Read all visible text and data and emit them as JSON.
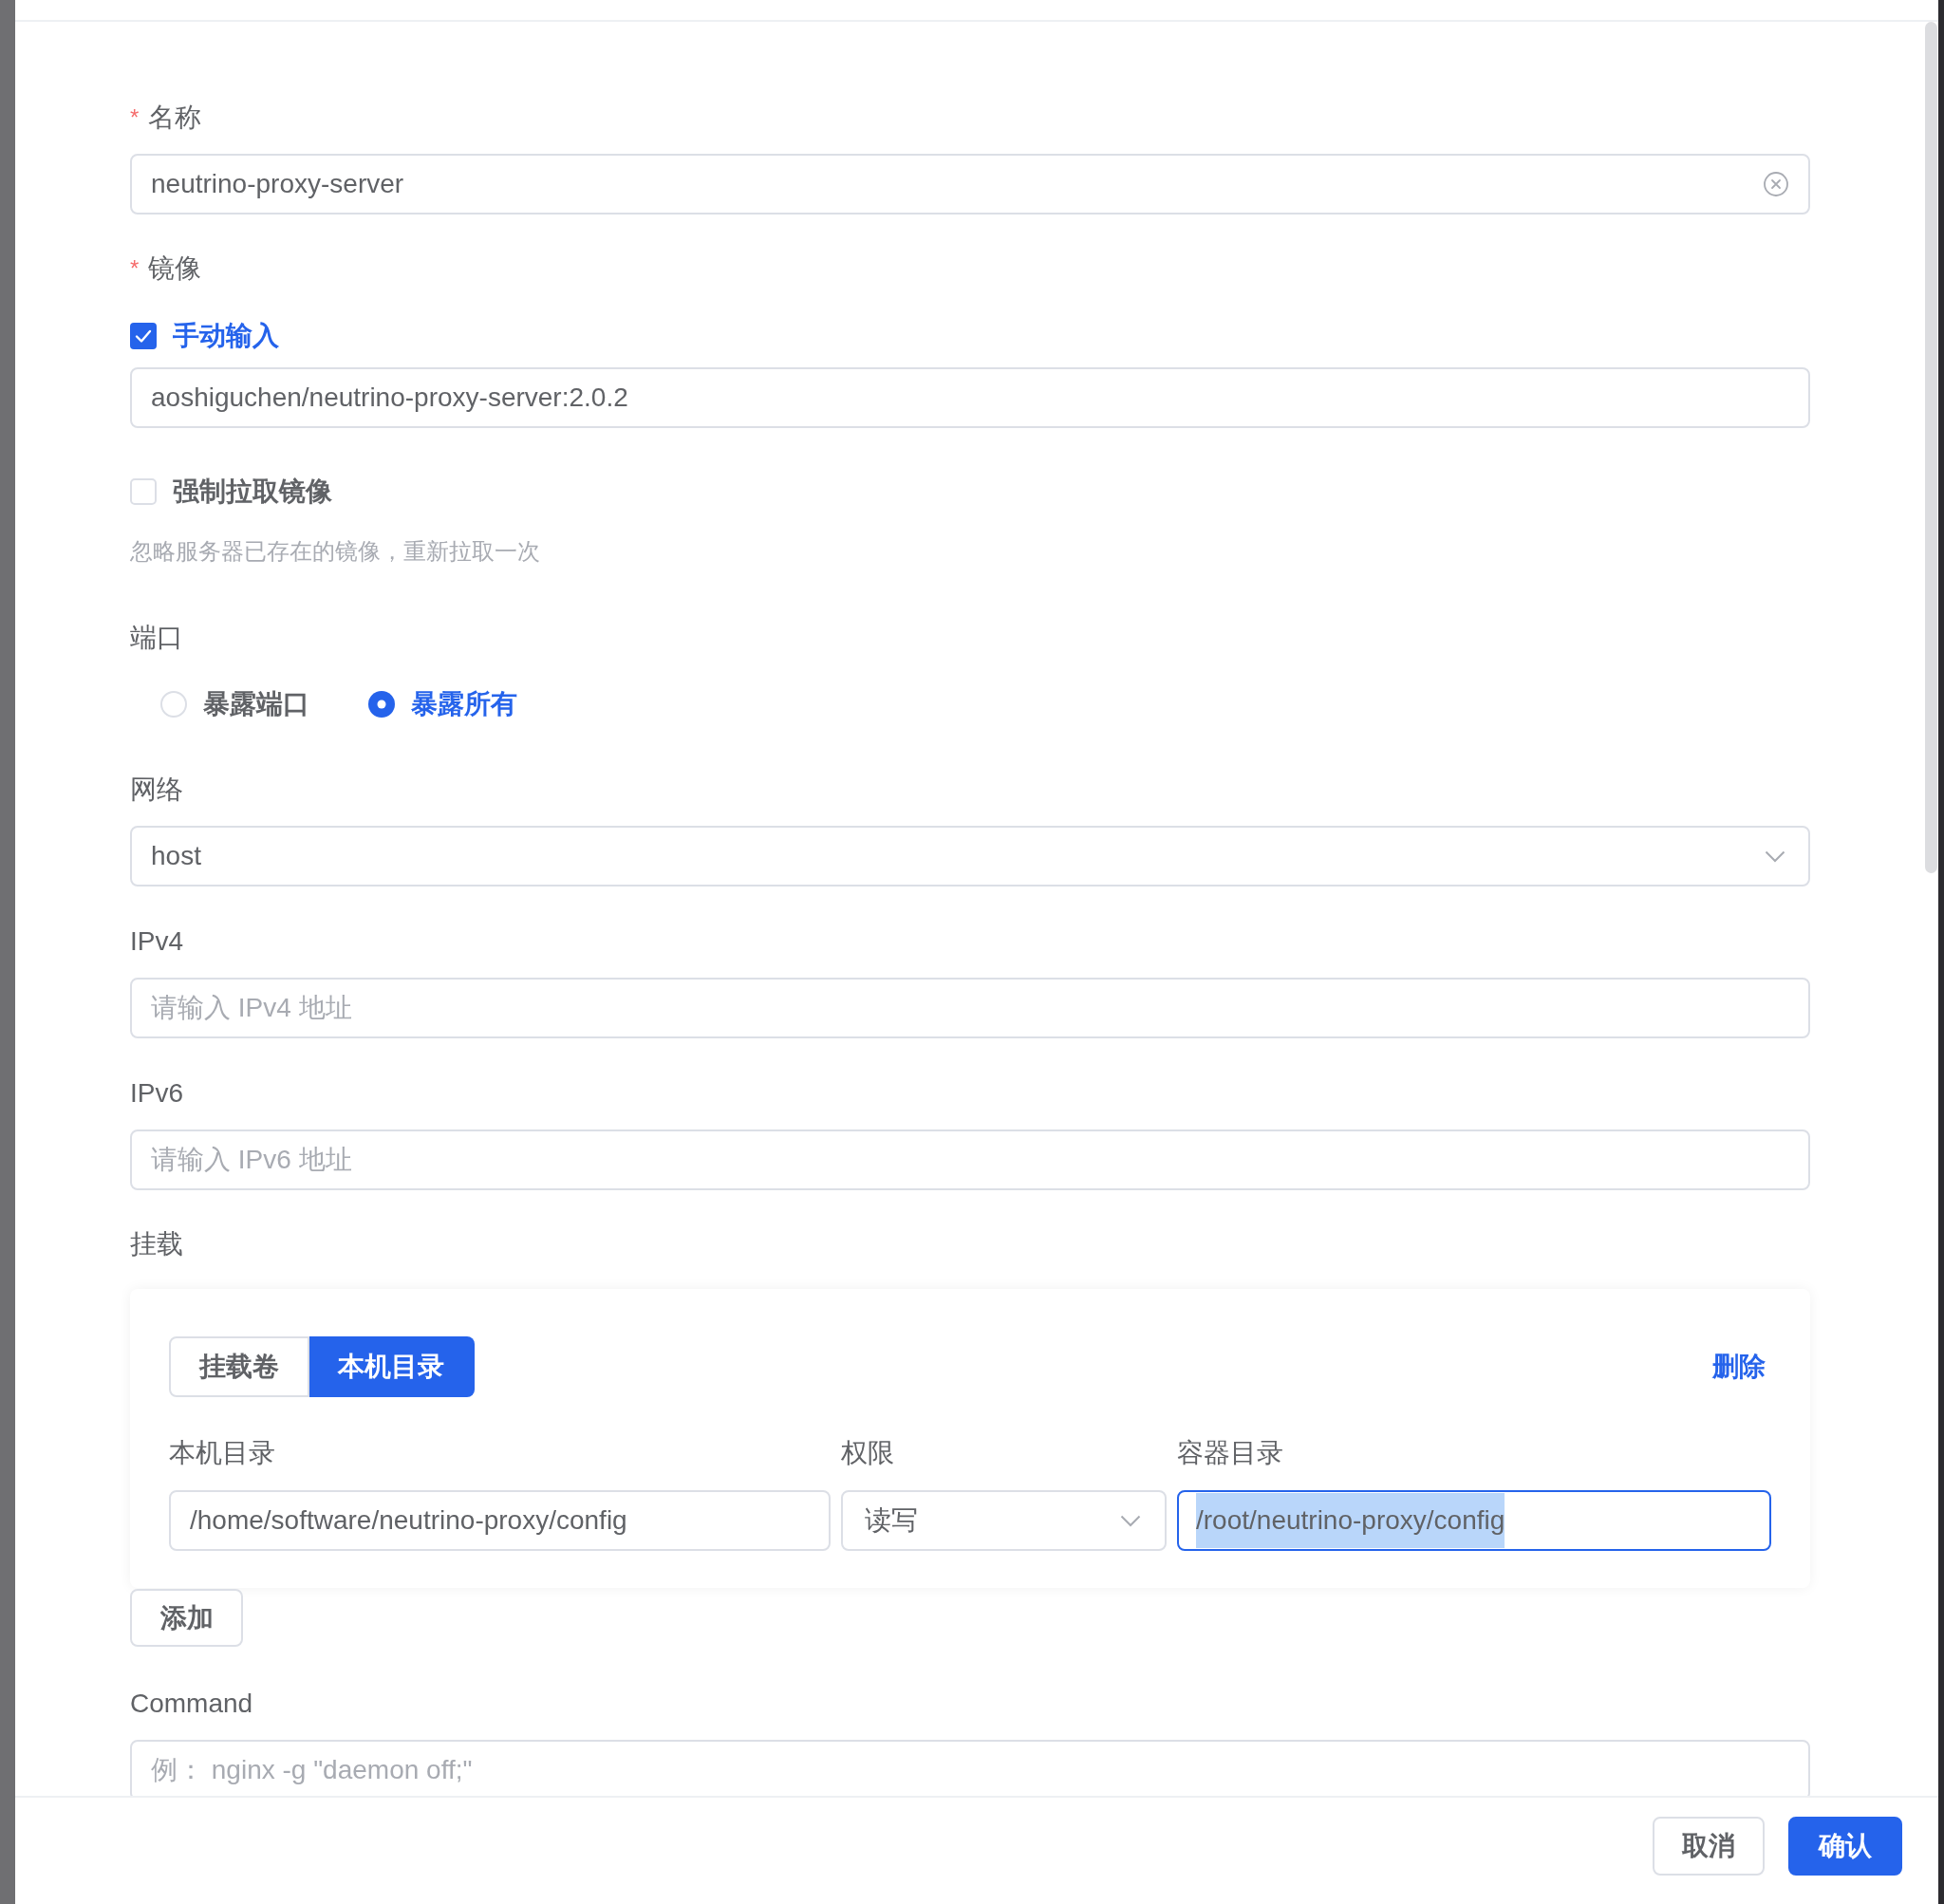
{
  "drawer": {
    "form": {
      "name": {
        "label": "名称",
        "required_mark": "*",
        "value": "neutrino-proxy-server",
        "clearable": true
      },
      "image": {
        "label": "镜像",
        "required_mark": "*",
        "manual_input": {
          "label": "手动输入",
          "checked": true
        },
        "value": "aoshiguchen/neutrino-proxy-server:2.0.2",
        "force_pull": {
          "label": "强制拉取镜像",
          "checked": false
        },
        "hint": "忽略服务器已存在的镜像，重新拉取一次"
      },
      "port": {
        "label": "端口",
        "options": [
          {
            "label": "暴露端口",
            "selected": false
          },
          {
            "label": "暴露所有",
            "selected": true
          }
        ]
      },
      "network": {
        "label": "网络",
        "value": "host"
      },
      "ipv4": {
        "label": "IPv4",
        "placeholder": "请输入 IPv4 地址"
      },
      "ipv6": {
        "label": "IPv6",
        "placeholder": "请输入 IPv6 地址"
      },
      "mounts": {
        "label": "挂载",
        "entries": [
          {
            "tabs": [
              {
                "label": "挂载卷",
                "selected": false
              },
              {
                "label": "本机目录",
                "selected": true
              }
            ],
            "delete_label": "删除",
            "columns": [
              "本机目录",
              "权限",
              "容器目录"
            ],
            "host_dir": "/home/software/neutrino-proxy/config",
            "permission": "读写",
            "container_dir": {
              "value": "/root/neutrino-proxy/config",
              "focused": true,
              "text_highlighted": true
            }
          }
        ],
        "add_label": "添加"
      },
      "command": {
        "label": "Command",
        "placeholder": "例： nginx -g \"daemon off;\""
      }
    },
    "footer": {
      "buttons": [
        {
          "label": "取消",
          "kind": "default"
        },
        {
          "label": "确认",
          "kind": "primary"
        }
      ]
    }
  }
}
